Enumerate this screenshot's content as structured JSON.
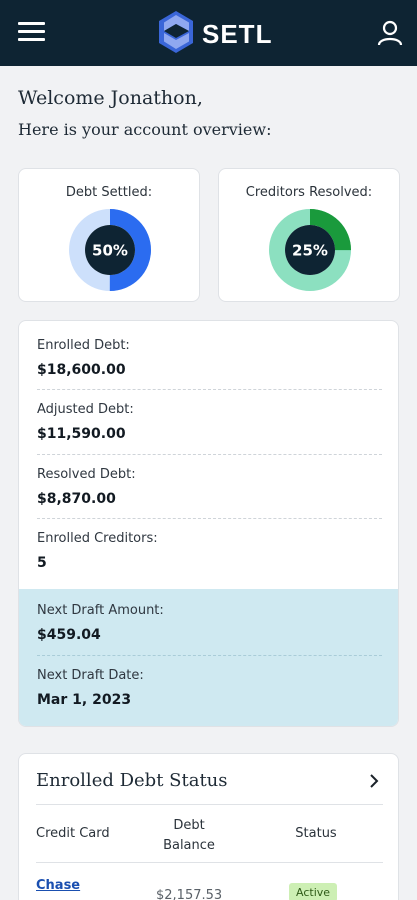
{
  "header": {
    "brand": "SETL",
    "icons": {
      "menu": "hamburger-menu-icon",
      "logo": "setl-logo-icon",
      "user": "user-profile-icon"
    },
    "colors": {
      "background": "#0e2433",
      "logo_light": "#8fa8f0",
      "logo_dark": "#3a66d8"
    }
  },
  "greeting": {
    "welcome": "Welcome Jonathon,",
    "subtitle": "Here is your account overview:"
  },
  "stats": [
    {
      "label": "Debt Settled:",
      "percent_text": "50%",
      "percent": 50,
      "color": "#2b6cf0",
      "track_color": "#cde0fb"
    },
    {
      "label": "Creditors Resolved:",
      "percent_text": "25%",
      "percent": 25,
      "color": "#1a9a3c",
      "track_color": "#8ce0c0"
    }
  ],
  "summary": {
    "rows": [
      {
        "label": "Enrolled Debt:",
        "value": "$18,600.00"
      },
      {
        "label": "Adjusted Debt:",
        "value": "$11,590.00"
      },
      {
        "label": "Resolved Debt:",
        "value": "$8,870.00"
      },
      {
        "label": "Enrolled Creditors:",
        "value": "5"
      }
    ],
    "draft": [
      {
        "label": "Next Draft Amount:",
        "value": "$459.04"
      },
      {
        "label": "Next Draft Date:",
        "value": "Mar 1, 2023"
      }
    ]
  },
  "debt_status": {
    "title": "Enrolled Debt Status",
    "chevron_icon": "chevron-right-icon",
    "columns": [
      "Credit Card",
      "Debt\nBalance",
      "Status"
    ],
    "rows": [
      {
        "creditor": "Chase",
        "balance": "$2,157.53",
        "status": "Active"
      }
    ]
  }
}
